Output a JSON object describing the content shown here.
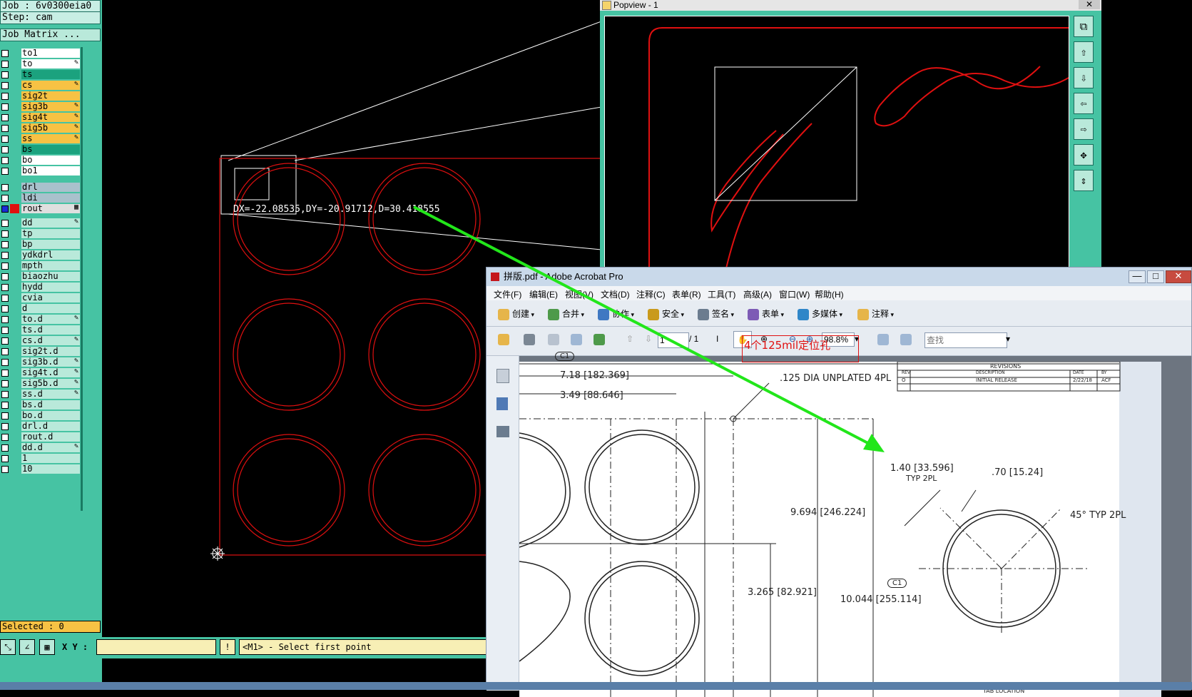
{
  "left_panel": {
    "job": "Job : 6v0300eia0",
    "step": "Step: cam",
    "job_matrix": "Job Matrix ...",
    "selected": "Selected : 0",
    "layers": [
      {
        "name": "to1",
        "color": "#ffffff",
        "flag": ""
      },
      {
        "name": "to",
        "color": "#ffffff",
        "flag": "✎"
      },
      {
        "name": "ts",
        "color": "#1ba27e",
        "flag": ""
      },
      {
        "name": "cs",
        "color": "#f7c244",
        "flag": "✎"
      },
      {
        "name": "sig2t",
        "color": "#f7c244",
        "flag": ""
      },
      {
        "name": "sig3b",
        "color": "#f7c244",
        "flag": "✎"
      },
      {
        "name": "sig4t",
        "color": "#f7c244",
        "flag": "✎"
      },
      {
        "name": "sig5b",
        "color": "#f7c244",
        "flag": "✎"
      },
      {
        "name": "ss",
        "color": "#f7c244",
        "flag": "✎"
      },
      {
        "name": "bs",
        "color": "#1ba27e",
        "flag": ""
      },
      {
        "name": "bo",
        "color": "#ffffff",
        "flag": ""
      },
      {
        "name": "bo1",
        "color": "#ffffff",
        "flag": ""
      },
      {
        "name": "drl",
        "color": "#a9c1cc",
        "flag": ""
      },
      {
        "name": "ldi",
        "color": "#a9c1cc",
        "flag": ""
      },
      {
        "name": "rout",
        "color": "#dfdfdf",
        "flag": "▦"
      },
      {
        "name": "dd",
        "color": "#b9e9da",
        "flag": "✎"
      },
      {
        "name": "tp",
        "color": "#b9e9da",
        "flag": ""
      },
      {
        "name": "bp",
        "color": "#b9e9da",
        "flag": ""
      },
      {
        "name": "ydkdrl",
        "color": "#b9e9da",
        "flag": ""
      },
      {
        "name": "mpth",
        "color": "#b9e9da",
        "flag": ""
      },
      {
        "name": "biaozhu",
        "color": "#b9e9da",
        "flag": ""
      },
      {
        "name": "hydd",
        "color": "#b9e9da",
        "flag": ""
      },
      {
        "name": "cvia",
        "color": "#b9e9da",
        "flag": ""
      },
      {
        "name": "d",
        "color": "#b9e9da",
        "flag": ""
      },
      {
        "name": "to.d",
        "color": "#b9e9da",
        "flag": "✎"
      },
      {
        "name": "ts.d",
        "color": "#b9e9da",
        "flag": ""
      },
      {
        "name": "cs.d",
        "color": "#b9e9da",
        "flag": "✎"
      },
      {
        "name": "sig2t.d",
        "color": "#b9e9da",
        "flag": ""
      },
      {
        "name": "sig3b.d",
        "color": "#b9e9da",
        "flag": "✎"
      },
      {
        "name": "sig4t.d",
        "color": "#b9e9da",
        "flag": "✎"
      },
      {
        "name": "sig5b.d",
        "color": "#b9e9da",
        "flag": "✎"
      },
      {
        "name": "ss.d",
        "color": "#b9e9da",
        "flag": "✎"
      },
      {
        "name": "bs.d",
        "color": "#b9e9da",
        "flag": ""
      },
      {
        "name": "bo.d",
        "color": "#b9e9da",
        "flag": ""
      },
      {
        "name": "drl.d",
        "color": "#b9e9da",
        "flag": ""
      },
      {
        "name": "rout.d",
        "color": "#b9e9da",
        "flag": ""
      },
      {
        "name": "dd.d",
        "color": "#b9e9da",
        "flag": "✎"
      },
      {
        "name": "1",
        "color": "#b9e9da",
        "flag": ""
      },
      {
        "name": "10",
        "color": "#b9e9da",
        "flag": ""
      }
    ]
  },
  "measure": {
    "readout": "DX=-22.08535,DY=-20.91712,D=30.418555"
  },
  "cam_bar": {
    "xy_label": "X Y :",
    "xy_value": "",
    "prompt": "<M1> - Select first point"
  },
  "popview": {
    "title": "Popview - 1",
    "close": "✕"
  },
  "acrobat": {
    "title": "拼版.pdf - Adobe Acrobat Pro",
    "menu": [
      "文件(F)",
      "编辑(E)",
      "视图(V)",
      "文档(D)",
      "注释(C)",
      "表单(R)",
      "工具(T)",
      "高级(A)",
      "窗口(W)",
      "帮助(H)"
    ],
    "toolbar1": [
      "创建",
      "合并",
      "协作",
      "安全",
      "签名",
      "表单",
      "多媒体",
      "注释"
    ],
    "page_current": "1",
    "page_total": "/ 1",
    "zoom": "98.8%",
    "search_placeholder": "查找",
    "annotation": "4个125mil定位孔",
    "revisions": {
      "title": "REVISIONS",
      "cols": [
        "REV",
        "DESCRIPTION",
        "DATE",
        "BY"
      ],
      "row": [
        "O",
        "INITIAL RELEASE",
        "2/22/18",
        "ACF"
      ]
    },
    "dims": {
      "d1": "7.18 [182.369]",
      "d2": "3.49 [88.646]",
      "hole": ".125 DIA UNPLATED 4PL",
      "d3": "9.694 [246.224]",
      "d4": "3.265 [82.921]",
      "d5": "10.044 [255.114]",
      "d6": "1.40 [33.596]",
      "d6b": "TYP 2PL",
      "d7": ".70 [15.24]",
      "d8": "45° TYP 2PL",
      "c1": "C1",
      "c2": "C1",
      "tab": "TAB LOCATION"
    }
  },
  "colors": {
    "cam_bg": "#46c3a3",
    "profile_red": "#e01010",
    "arrow_green": "#22e61a",
    "annot_red": "#e01010"
  }
}
